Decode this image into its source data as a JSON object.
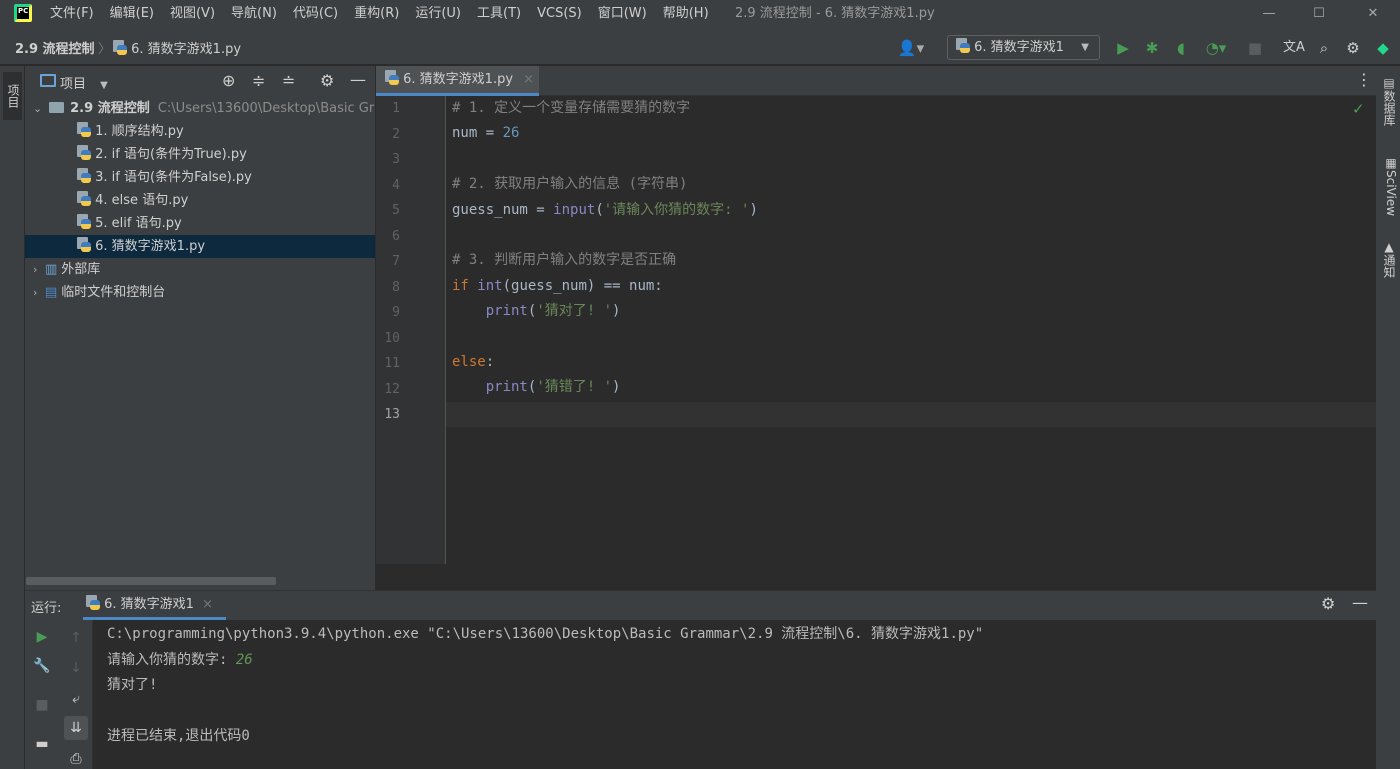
{
  "menubar": {
    "items": [
      "文件(F)",
      "编辑(E)",
      "视图(V)",
      "导航(N)",
      "代码(C)",
      "重构(R)",
      "运行(U)",
      "工具(T)",
      "VCS(S)",
      "窗口(W)",
      "帮助(H)"
    ],
    "window_title": "2.9 流程控制 - 6. 猜数字游戏1.py",
    "minimize": "—",
    "maximize": "☐",
    "close": "✕"
  },
  "navbar": {
    "project": "2.9 流程控制",
    "separator": "〉",
    "file": "6. 猜数字游戏1.py",
    "run_config": "6. 猜数字游戏1",
    "run_config_arrow": "▼"
  },
  "left_strip": {
    "project_tab": "项目"
  },
  "project": {
    "title": "项目",
    "root": {
      "name": "2.9 流程控制",
      "path": "C:\\Users\\13600\\Desktop\\Basic Gr"
    },
    "files": [
      "1. 顺序结构.py",
      "2. if 语句(条件为True).py",
      "3. if 语句(条件为False).py",
      "4. else 语句.py",
      "5. elif 语句.py",
      "6. 猜数字游戏1.py"
    ],
    "external_libs": "外部库",
    "scratches": "临时文件和控制台"
  },
  "editor": {
    "tab_label": "6. 猜数字游戏1.py",
    "tab_close": "×",
    "line_numbers": [
      "1",
      "2",
      "3",
      "4",
      "5",
      "6",
      "7",
      "8",
      "9",
      "10",
      "11",
      "12",
      "13"
    ],
    "lines": {
      "l1": "# 1. 定义一个变量存储需要猜的数字",
      "l2_var": "num",
      "l2_op": " = ",
      "l2_val": "26",
      "l4": "# 2. 获取用户输入的信息 (字符串)",
      "l5_var": "guess_num = ",
      "l5_fn": "input",
      "l5_open": "(",
      "l5_str": "'请输入你猜的数字: '",
      "l5_close": ")",
      "l7": "# 3. 判断用户输入的数字是否正确",
      "l8_kw": "if",
      "l8_sp": " ",
      "l8_fn": "int",
      "l8_rest": "(guess_num) == num:",
      "l9_indent": "    ",
      "l9_fn": "print",
      "l9_open": "(",
      "l9_str": "'猜对了! '",
      "l9_close": ")",
      "l11_kw": "else",
      "l11_colon": ":",
      "l12_indent": "    ",
      "l12_fn": "print",
      "l12_open": "(",
      "l12_str": "'猜错了! '",
      "l12_close": ")"
    },
    "check_mark": "✓"
  },
  "right_strip": {
    "database": "数据库",
    "sciview": "SciView",
    "notifications": "通知"
  },
  "run": {
    "label": "运行:",
    "tab_label": "6. 猜数字游戏1",
    "tab_close": "×",
    "console": {
      "cmd": "C:\\programming\\python3.9.4\\python.exe \"C:\\Users\\13600\\Desktop\\Basic Grammar\\2.9 流程控制\\6. 猜数字游戏1.py\"",
      "prompt": "请输入你猜的数字: ",
      "input": "26",
      "result": "猜对了!",
      "exit": "进程已结束,退出代码0"
    }
  },
  "colors": {
    "accent": "#4a88c7",
    "run_green": "#499c54",
    "selection": "#0d293e"
  }
}
